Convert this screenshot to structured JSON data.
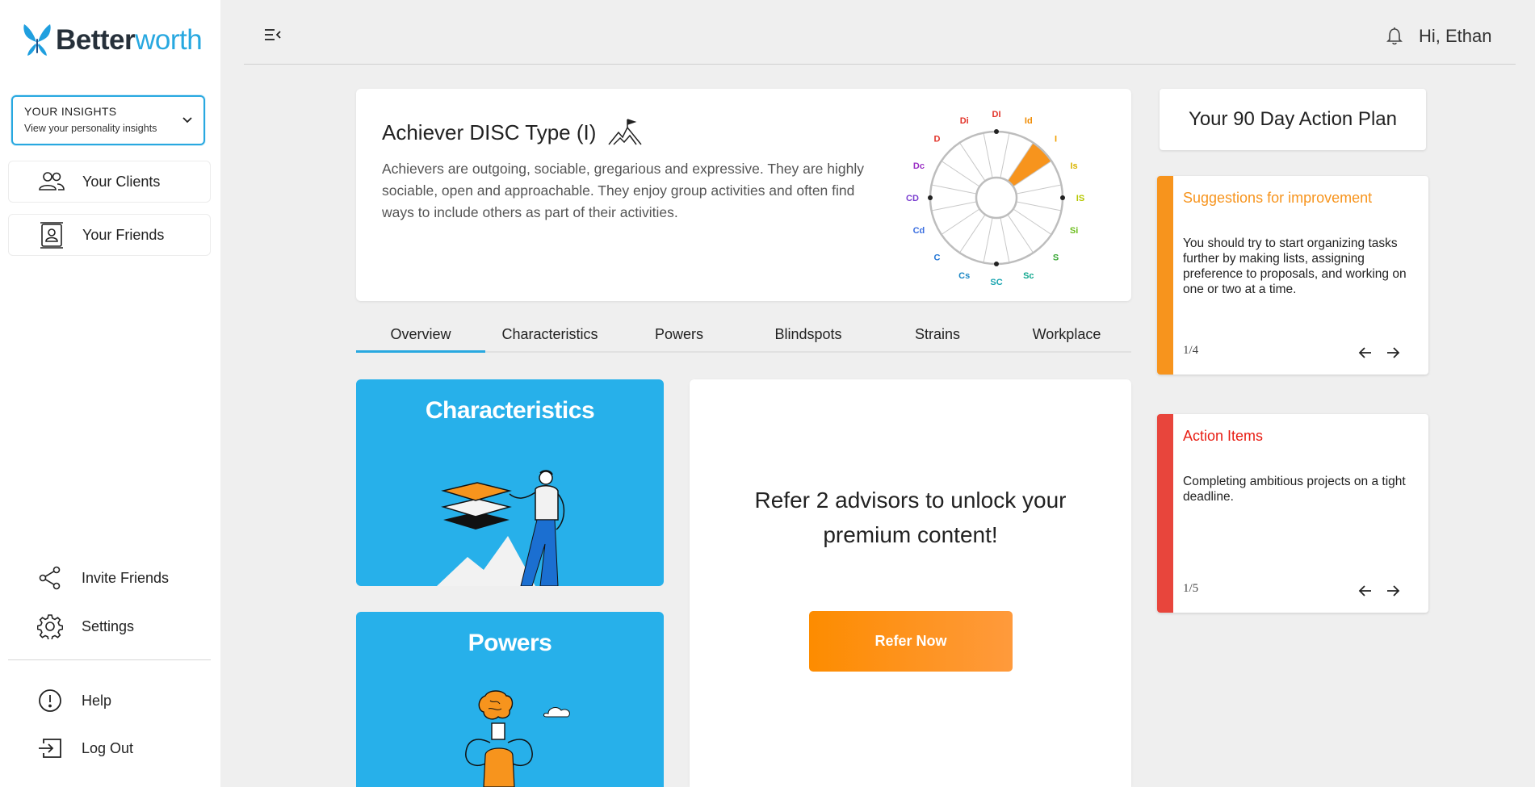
{
  "brand": {
    "bold": "Better",
    "light": "worth"
  },
  "sidebar": {
    "insights_title": "YOUR INSIGHTS",
    "insights_subtitle": "View your personality insights",
    "clients": "Your Clients",
    "friends": "Your Friends",
    "invite": "Invite Friends",
    "settings": "Settings",
    "help": "Help",
    "logout": "Log Out"
  },
  "header": {
    "greeting": "Hi, Ethan"
  },
  "hero": {
    "title": "Achiever DISC Type (I)",
    "description": "Achievers are outgoing, sociable, gregarious and expressive. They are highly sociable, open and approachable. They enjoy group activities and often find ways to include others as part of their activities.",
    "wheel_highlight": "I",
    "wheel_labels": [
      {
        "t": "Di",
        "c": "#e2342a"
      },
      {
        "t": "DI",
        "c": "#e2342a"
      },
      {
        "t": "Id",
        "c": "#f08a00"
      },
      {
        "t": "I",
        "c": "#f0a000"
      },
      {
        "t": "Is",
        "c": "#d9b400"
      },
      {
        "t": "IS",
        "c": "#b6c800"
      },
      {
        "t": "Si",
        "c": "#6cbd1e"
      },
      {
        "t": "S",
        "c": "#3aa836"
      },
      {
        "t": "Sc",
        "c": "#13a88f"
      },
      {
        "t": "SC",
        "c": "#1aa5b0"
      },
      {
        "t": "Cs",
        "c": "#1c87c4"
      },
      {
        "t": "C",
        "c": "#2477d6"
      },
      {
        "t": "Cd",
        "c": "#3b6fe0"
      },
      {
        "t": "CD",
        "c": "#7b3fd0"
      },
      {
        "t": "Dc",
        "c": "#9a2fc4"
      },
      {
        "t": "D",
        "c": "#e2342a"
      }
    ]
  },
  "tabs": [
    "Overview",
    "Characteristics",
    "Powers",
    "Blindspots",
    "Strains",
    "Workplace"
  ],
  "cards": {
    "characteristics": "Characteristics",
    "powers": "Powers"
  },
  "refer": {
    "text": "Refer 2 advisors to unlock your premium content!",
    "button": "Refer Now"
  },
  "plan": {
    "title": "Your 90 Day Action Plan"
  },
  "suggestions": {
    "title": "Suggestions for improvement",
    "body": "You should try to start organizing tasks further by making lists, assigning preference to proposals, and working on one or two at a time.",
    "page": "1/4",
    "color": "#f7941d"
  },
  "actions": {
    "title": "Action Items",
    "body": "Completing ambitious projects on a tight deadline.",
    "page": "1/5",
    "color": "#e8453c"
  },
  "accent": "#28a8e0"
}
